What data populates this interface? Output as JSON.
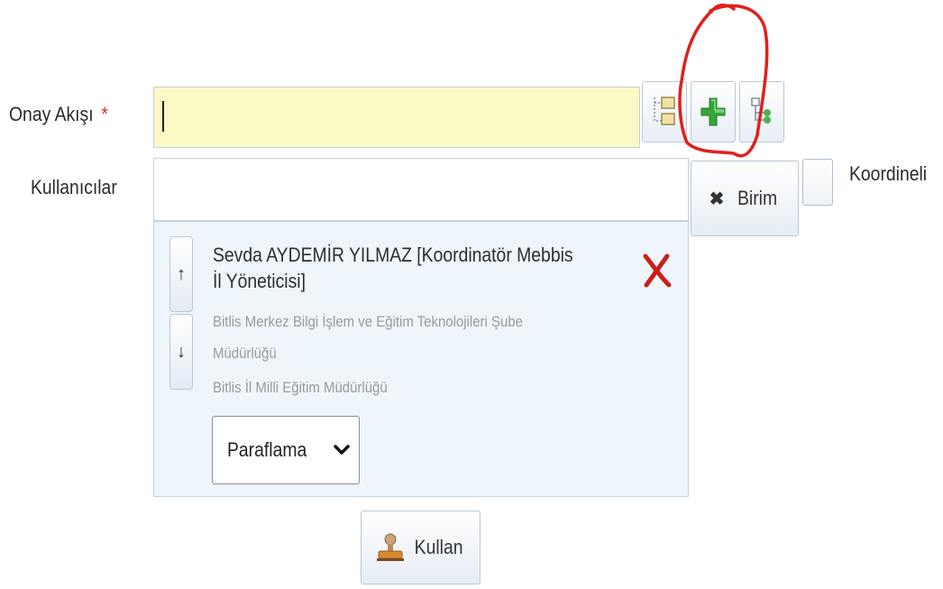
{
  "form": {
    "onay_label": "Onay Akışı",
    "required_mark": "*",
    "onay_value": "",
    "kullanicilar_label": "Kullanıcılar",
    "kullanicilar_value": ""
  },
  "toolbar": {
    "buttons": [
      {
        "icon": "org-chart-icon"
      },
      {
        "icon": "green-plus-icon"
      },
      {
        "icon": "workflow-icon"
      }
    ]
  },
  "birim_button": {
    "icon": "x-icon",
    "label": "Birim"
  },
  "koordineli": {
    "label": "Koordineli",
    "checked": false
  },
  "user_list": [
    {
      "name": "Sevda AYDEMİR YILMAZ [Koordinatör Mebbis İl Yöneticisi]",
      "unit": "Bitlis Merkez Bilgi İşlem ve Eğitim Teknolojileri Şube",
      "unit_cont": "Müdürlüğü",
      "org": "Bitlis İl Milli Eğitim Müdürlüğü",
      "action": "Paraflama"
    }
  ],
  "kullan_button": {
    "label": "Kullan",
    "icon": "stamp-icon"
  },
  "colors": {
    "input_highlight": "#fbf9c4",
    "annotation": "#e0201c",
    "remove": "#c8201a"
  }
}
